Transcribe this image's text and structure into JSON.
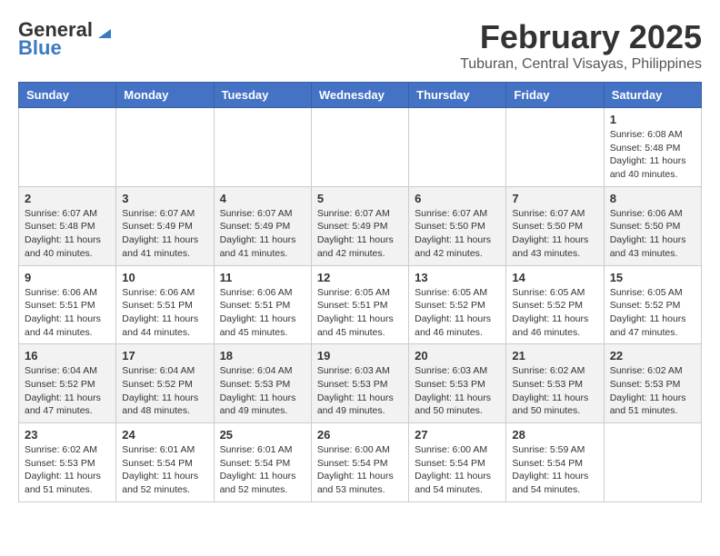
{
  "logo": {
    "general": "General",
    "blue": "Blue"
  },
  "header": {
    "month": "February 2025",
    "location": "Tuburan, Central Visayas, Philippines"
  },
  "days_of_week": [
    "Sunday",
    "Monday",
    "Tuesday",
    "Wednesday",
    "Thursday",
    "Friday",
    "Saturday"
  ],
  "weeks": [
    [
      {
        "day": "",
        "info": ""
      },
      {
        "day": "",
        "info": ""
      },
      {
        "day": "",
        "info": ""
      },
      {
        "day": "",
        "info": ""
      },
      {
        "day": "",
        "info": ""
      },
      {
        "day": "",
        "info": ""
      },
      {
        "day": "1",
        "info": "Sunrise: 6:08 AM\nSunset: 5:48 PM\nDaylight: 11 hours and 40 minutes."
      }
    ],
    [
      {
        "day": "2",
        "info": "Sunrise: 6:07 AM\nSunset: 5:48 PM\nDaylight: 11 hours and 40 minutes."
      },
      {
        "day": "3",
        "info": "Sunrise: 6:07 AM\nSunset: 5:49 PM\nDaylight: 11 hours and 41 minutes."
      },
      {
        "day": "4",
        "info": "Sunrise: 6:07 AM\nSunset: 5:49 PM\nDaylight: 11 hours and 41 minutes."
      },
      {
        "day": "5",
        "info": "Sunrise: 6:07 AM\nSunset: 5:49 PM\nDaylight: 11 hours and 42 minutes."
      },
      {
        "day": "6",
        "info": "Sunrise: 6:07 AM\nSunset: 5:50 PM\nDaylight: 11 hours and 42 minutes."
      },
      {
        "day": "7",
        "info": "Sunrise: 6:07 AM\nSunset: 5:50 PM\nDaylight: 11 hours and 43 minutes."
      },
      {
        "day": "8",
        "info": "Sunrise: 6:06 AM\nSunset: 5:50 PM\nDaylight: 11 hours and 43 minutes."
      }
    ],
    [
      {
        "day": "9",
        "info": "Sunrise: 6:06 AM\nSunset: 5:51 PM\nDaylight: 11 hours and 44 minutes."
      },
      {
        "day": "10",
        "info": "Sunrise: 6:06 AM\nSunset: 5:51 PM\nDaylight: 11 hours and 44 minutes."
      },
      {
        "day": "11",
        "info": "Sunrise: 6:06 AM\nSunset: 5:51 PM\nDaylight: 11 hours and 45 minutes."
      },
      {
        "day": "12",
        "info": "Sunrise: 6:05 AM\nSunset: 5:51 PM\nDaylight: 11 hours and 45 minutes."
      },
      {
        "day": "13",
        "info": "Sunrise: 6:05 AM\nSunset: 5:52 PM\nDaylight: 11 hours and 46 minutes."
      },
      {
        "day": "14",
        "info": "Sunrise: 6:05 AM\nSunset: 5:52 PM\nDaylight: 11 hours and 46 minutes."
      },
      {
        "day": "15",
        "info": "Sunrise: 6:05 AM\nSunset: 5:52 PM\nDaylight: 11 hours and 47 minutes."
      }
    ],
    [
      {
        "day": "16",
        "info": "Sunrise: 6:04 AM\nSunset: 5:52 PM\nDaylight: 11 hours and 47 minutes."
      },
      {
        "day": "17",
        "info": "Sunrise: 6:04 AM\nSunset: 5:52 PM\nDaylight: 11 hours and 48 minutes."
      },
      {
        "day": "18",
        "info": "Sunrise: 6:04 AM\nSunset: 5:53 PM\nDaylight: 11 hours and 49 minutes."
      },
      {
        "day": "19",
        "info": "Sunrise: 6:03 AM\nSunset: 5:53 PM\nDaylight: 11 hours and 49 minutes."
      },
      {
        "day": "20",
        "info": "Sunrise: 6:03 AM\nSunset: 5:53 PM\nDaylight: 11 hours and 50 minutes."
      },
      {
        "day": "21",
        "info": "Sunrise: 6:02 AM\nSunset: 5:53 PM\nDaylight: 11 hours and 50 minutes."
      },
      {
        "day": "22",
        "info": "Sunrise: 6:02 AM\nSunset: 5:53 PM\nDaylight: 11 hours and 51 minutes."
      }
    ],
    [
      {
        "day": "23",
        "info": "Sunrise: 6:02 AM\nSunset: 5:53 PM\nDaylight: 11 hours and 51 minutes."
      },
      {
        "day": "24",
        "info": "Sunrise: 6:01 AM\nSunset: 5:54 PM\nDaylight: 11 hours and 52 minutes."
      },
      {
        "day": "25",
        "info": "Sunrise: 6:01 AM\nSunset: 5:54 PM\nDaylight: 11 hours and 52 minutes."
      },
      {
        "day": "26",
        "info": "Sunrise: 6:00 AM\nSunset: 5:54 PM\nDaylight: 11 hours and 53 minutes."
      },
      {
        "day": "27",
        "info": "Sunrise: 6:00 AM\nSunset: 5:54 PM\nDaylight: 11 hours and 54 minutes."
      },
      {
        "day": "28",
        "info": "Sunrise: 5:59 AM\nSunset: 5:54 PM\nDaylight: 11 hours and 54 minutes."
      },
      {
        "day": "",
        "info": ""
      }
    ]
  ]
}
